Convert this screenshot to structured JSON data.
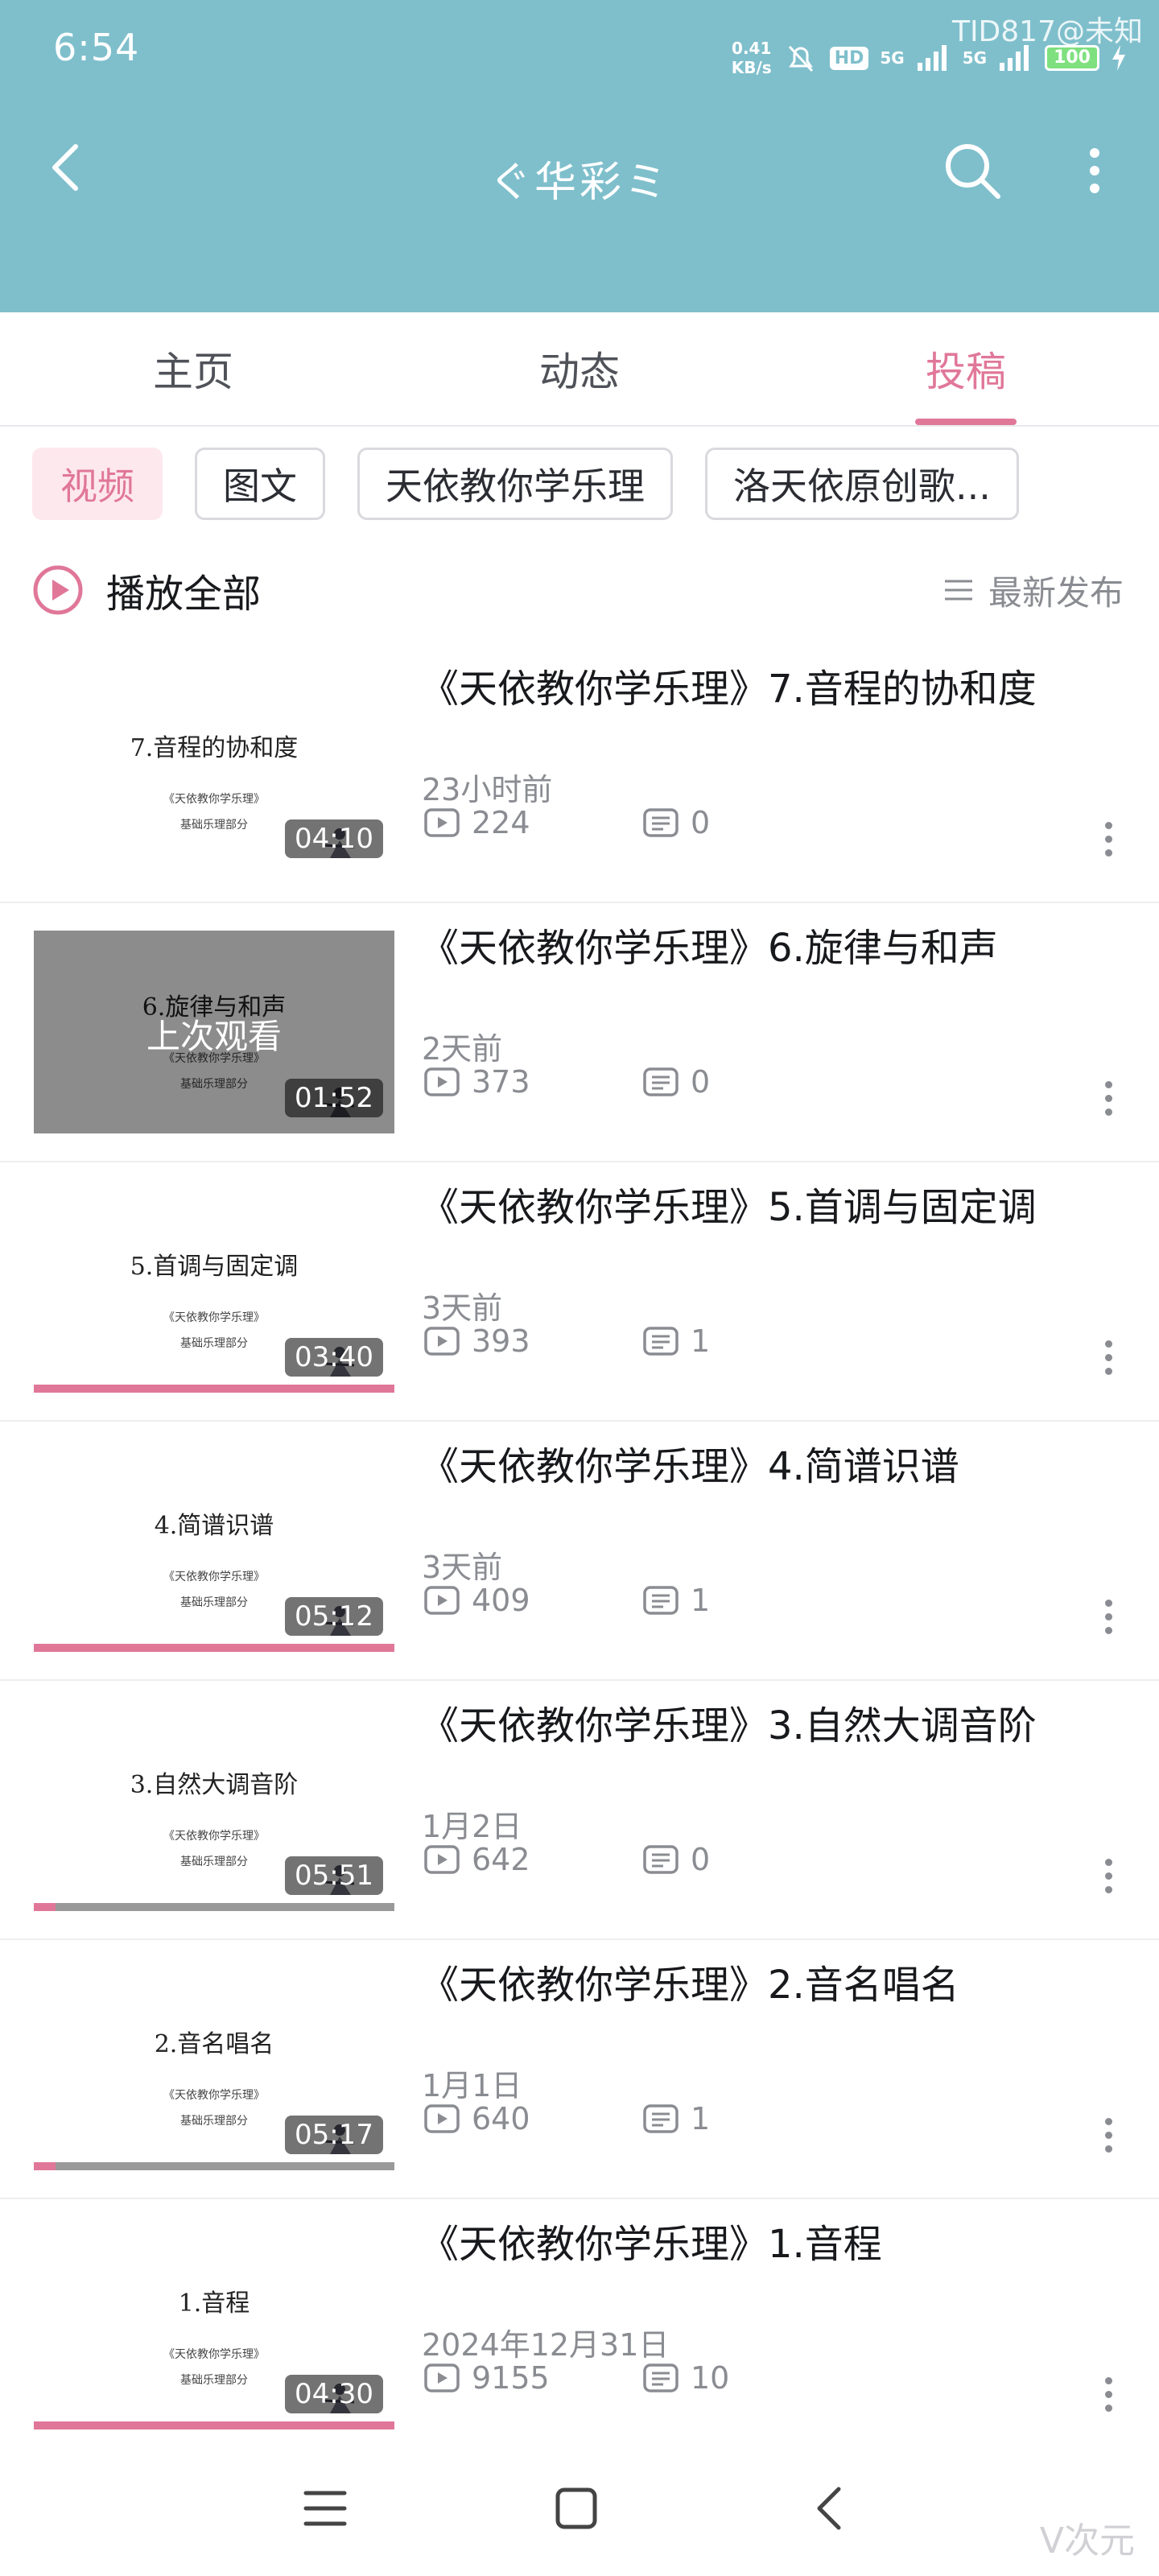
{
  "status_bar": {
    "time": "6:54",
    "net_speed": "0.41",
    "net_unit": "KB/s",
    "hd": "HD",
    "sim1": "5G",
    "sim2": "5G",
    "battery": "100",
    "watermark": "TID817@未知"
  },
  "header": {
    "title": "ぐ华彩ミ"
  },
  "tabs": [
    {
      "label": "主页"
    },
    {
      "label": "动态"
    },
    {
      "label": "投稿"
    }
  ],
  "filters": [
    {
      "label": "视频"
    },
    {
      "label": "图文"
    },
    {
      "label": "天依教你学乐理"
    },
    {
      "label": "洛天依原创歌..."
    }
  ],
  "play_all": {
    "label": "播放全部"
  },
  "sort": {
    "label": "最新发布"
  },
  "videos": [
    {
      "title": "《天依教你学乐理》7.音程的协和度",
      "thumb_title": "7.音程的协和度",
      "thumb_sub1": "《天依教你学乐理》",
      "thumb_sub2": "基础乐理部分",
      "duration": "04:10",
      "date": "23小时前",
      "plays": "224",
      "comments": "0",
      "progress": 0
    },
    {
      "title": "《天依教你学乐理》6.旋律与和声",
      "thumb_title": "6.旋律与和声",
      "thumb_sub1": "《天依教你学乐理》",
      "thumb_sub2": "基础乐理部分",
      "duration": "01:52",
      "date": "2天前",
      "plays": "373",
      "comments": "0",
      "last_watched": "上次观看",
      "progress": 0
    },
    {
      "title": "《天依教你学乐理》5.首调与固定调",
      "thumb_title": "5.首调与固定调",
      "thumb_sub1": "《天依教你学乐理》",
      "thumb_sub2": "基础乐理部分",
      "duration": "03:40",
      "date": "3天前",
      "plays": "393",
      "comments": "1",
      "progress": 1.0
    },
    {
      "title": "《天依教你学乐理》4.简谱识谱",
      "thumb_title": "4.简谱识谱",
      "thumb_sub1": "《天依教你学乐理》",
      "thumb_sub2": "基础乐理部分",
      "duration": "05:12",
      "date": "3天前",
      "plays": "409",
      "comments": "1",
      "progress": 1.0
    },
    {
      "title": "《天依教你学乐理》3.自然大调音阶",
      "thumb_title": "3.自然大调音阶",
      "thumb_sub1": "《天依教你学乐理》",
      "thumb_sub2": "基础乐理部分",
      "duration": "05:51",
      "date": "1月2日",
      "plays": "642",
      "comments": "0",
      "progress": 0.06
    },
    {
      "title": "《天依教你学乐理》2.音名唱名",
      "thumb_title": "2.音名唱名",
      "thumb_sub1": "《天依教你学乐理》",
      "thumb_sub2": "基础乐理部分",
      "duration": "05:17",
      "date": "1月1日",
      "plays": "640",
      "comments": "1",
      "progress": 0.06
    },
    {
      "title": "《天依教你学乐理》1.音程",
      "thumb_title": "1.音程",
      "thumb_sub1": "《天依教你学乐理》",
      "thumb_sub2": "基础乐理部分",
      "duration": "04:30",
      "date": "2024年12月31日",
      "plays": "9155",
      "comments": "10",
      "progress": 1.0
    }
  ],
  "bottom_watermark": "V次元",
  "colors": {
    "header_bg": "#7fbfcc",
    "accent_pink": "#e07799",
    "muted_text": "#8a8c92"
  }
}
